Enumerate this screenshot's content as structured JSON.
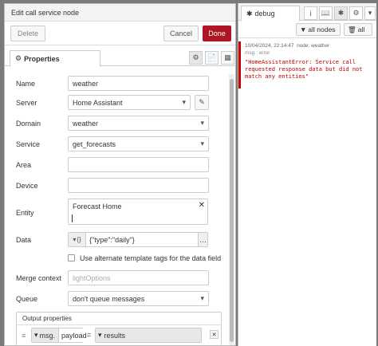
{
  "editor": {
    "title": "Edit call service node",
    "buttons": {
      "delete": "Delete",
      "cancel": "Cancel",
      "done": "Done"
    },
    "tab_properties": "Properties",
    "fields": {
      "name": {
        "label": "Name",
        "value": "weather"
      },
      "server": {
        "label": "Server",
        "value": "Home Assistant"
      },
      "domain": {
        "label": "Domain",
        "value": "weather"
      },
      "service": {
        "label": "Service",
        "value": "get_forecasts"
      },
      "area": {
        "label": "Area",
        "value": ""
      },
      "device": {
        "label": "Device",
        "value": ""
      },
      "entity": {
        "label": "Entity",
        "value": "Forecast Home"
      },
      "data": {
        "label": "Data",
        "type": "{}",
        "value": "{\"type\":\"daily\"}"
      },
      "alt_tags": {
        "label": "Use alternate template tags for the data field",
        "checked": false
      },
      "merge_context": {
        "label": "Merge context",
        "placeholder": "lightOptions"
      },
      "queue": {
        "label": "Queue",
        "value": "don't queue messages"
      }
    },
    "output_properties": {
      "title": "Output properties",
      "prefix": "msg.",
      "property": "payload",
      "equals": "=",
      "value": "results"
    }
  },
  "debug": {
    "tab_label": "debug",
    "filter_nodes": "all nodes",
    "filter_all": "all",
    "message": {
      "timestamp": "10/04/2024, 22:14:47",
      "node": "node: weather",
      "meta": "msg : error",
      "text": "\"HomeAssistantError: Service call requested response data but did not match any entities\""
    }
  }
}
